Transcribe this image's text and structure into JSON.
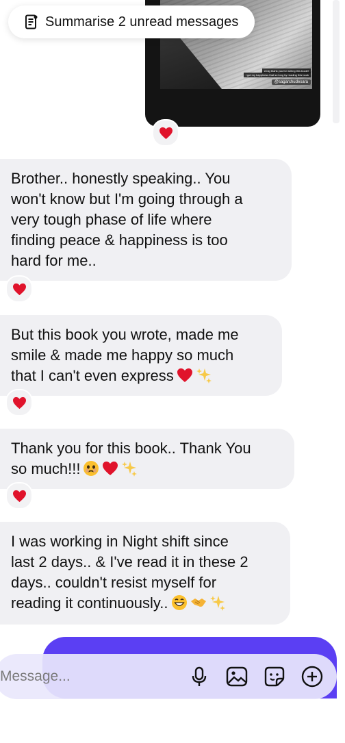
{
  "summary_pill": {
    "label": "Summarise 2 unread messages",
    "icon": "document-list-icon"
  },
  "shared_image": {
    "caption_line_1": "A big thank you for writing this book!!",
    "caption_line_2": "I got my happiness that so long by reading this book",
    "handle": "@sagarchudesara"
  },
  "messages": [
    {
      "lines": [
        "Brother.. honestly speaking.. You",
        "won't know but I'm going through a",
        "very tough phase of life where",
        "finding peace & happiness is too",
        "hard for me.."
      ],
      "reaction": "red-heart"
    },
    {
      "lines": [
        "But this book you wrote, made me",
        "smile & made me happy so much",
        "that I can't even express"
      ],
      "trailing_emojis": [
        "red-heart",
        "sparkles"
      ],
      "reaction": "red-heart"
    },
    {
      "lines": [
        "Thank you for this book.. Thank You",
        "so much!!!"
      ],
      "trailing_emojis": [
        "face-holding-back-tears",
        "red-heart",
        "sparkles"
      ],
      "reaction": "red-heart"
    },
    {
      "lines": [
        "I was working in Night shift since",
        "last 2 days.. & I've read it in these 2",
        "days.. couldn't resist myself for",
        "reading it continuously.."
      ],
      "trailing_emojis": [
        "grinning-face",
        "handshake",
        "sparkles"
      ]
    }
  ],
  "composer": {
    "placeholder": "Message...",
    "icons": [
      "microphone-icon",
      "gallery-icon",
      "sticker-icon",
      "plus-circle-icon"
    ]
  },
  "colors": {
    "incoming_bubble": "#f0f0f3",
    "outgoing_bubble": "#5b3ff3",
    "composer_bg": "#e9e7fc",
    "heart": "#e0132b"
  }
}
